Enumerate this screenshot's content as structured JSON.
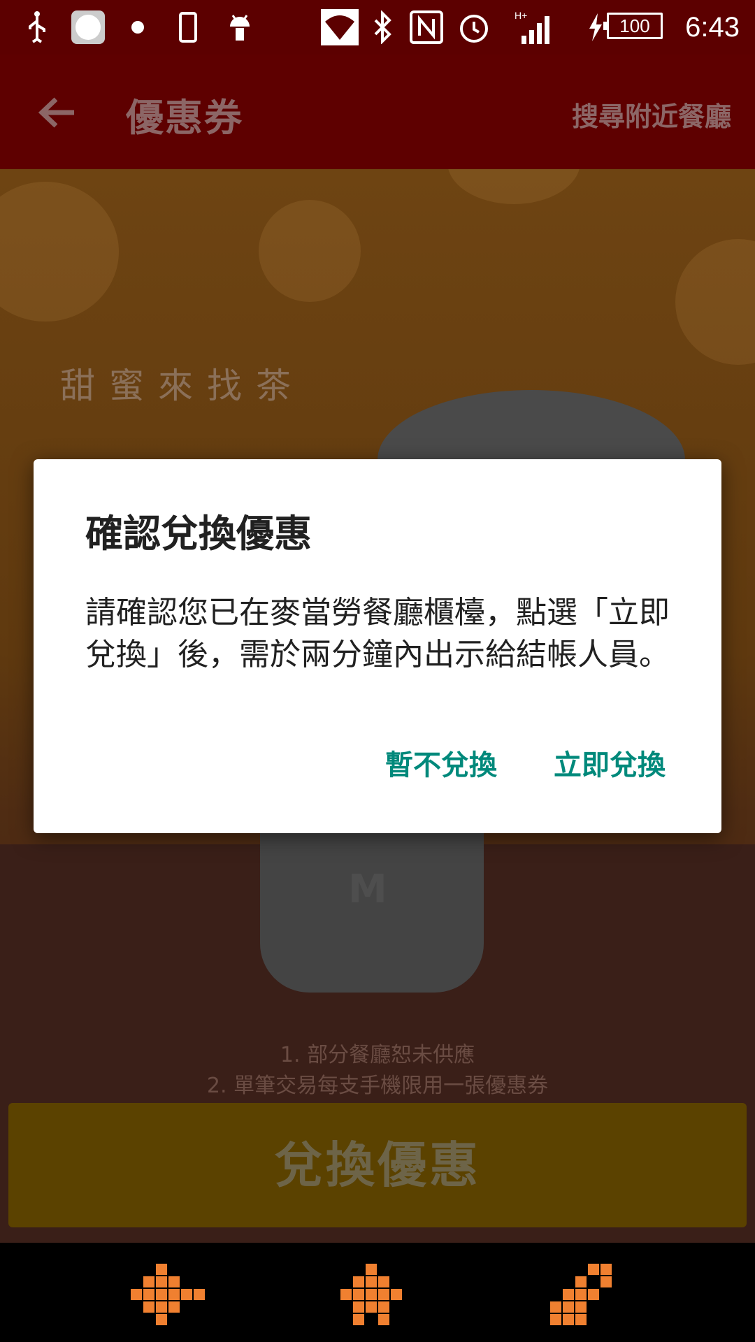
{
  "status_bar": {
    "time": "6:43",
    "battery": "100",
    "network": "H+",
    "icons": [
      "usb-icon",
      "app-icon",
      "dot-icon",
      "phone-icon",
      "android-icon",
      "wifi-icon",
      "bluetooth-icon",
      "nfc-icon",
      "alarm-icon",
      "signal-icon",
      "charging-icon",
      "battery-icon"
    ]
  },
  "app_bar": {
    "title": "優惠券",
    "action": "搜尋附近餐廳"
  },
  "content": {
    "tagline": "甜蜜來找茶",
    "cup_logo": "M",
    "notes": [
      "1. 部分餐廳恕未供應",
      "2. 單筆交易每支手機限用一張優惠券"
    ],
    "redeem_button": "兌換優惠"
  },
  "dialog": {
    "title": "確認兌換優惠",
    "body": "請確認您已在麥當勞餐廳櫃檯，點選「立即兌換」後，需於兩分鐘內出示給結帳人員。",
    "cancel": "暫不兌換",
    "confirm": "立即兌換"
  },
  "colors": {
    "app_bar": "#5e0000",
    "dialog_button": "#00897b",
    "nav_icon": "#f08030"
  },
  "nav_bar": {
    "icons": [
      "nav-back-icon",
      "nav-home-icon",
      "nav-recents-icon"
    ]
  }
}
